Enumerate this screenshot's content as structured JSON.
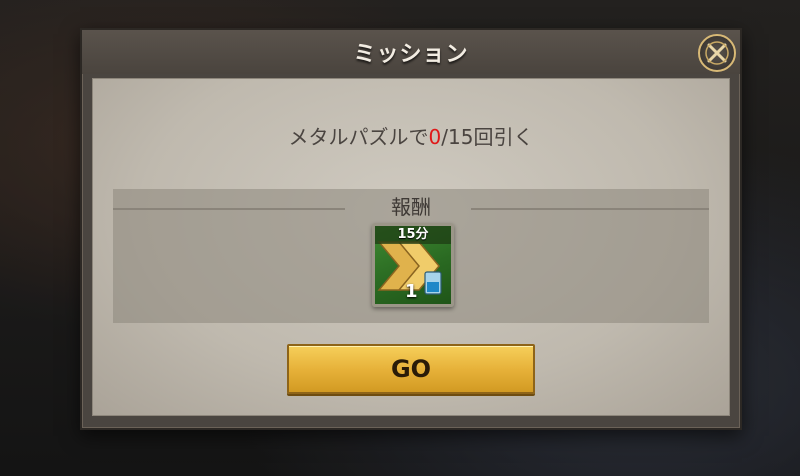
{
  "dialog": {
    "title": "ミッション",
    "close_icon": "close-x-icon"
  },
  "mission": {
    "prefix": "メタルパズルで",
    "current": "0",
    "separator": "/",
    "suffix": "15回引く"
  },
  "reward": {
    "title": "報酬",
    "item": {
      "icon": "speedup-chevron-icon",
      "duration": "15分",
      "quantity": "1"
    }
  },
  "actions": {
    "go_label": "GO"
  },
  "colors": {
    "accent_red": "#e01818",
    "button_gold": "#e7b23a",
    "item_green": "#2a6a22"
  }
}
